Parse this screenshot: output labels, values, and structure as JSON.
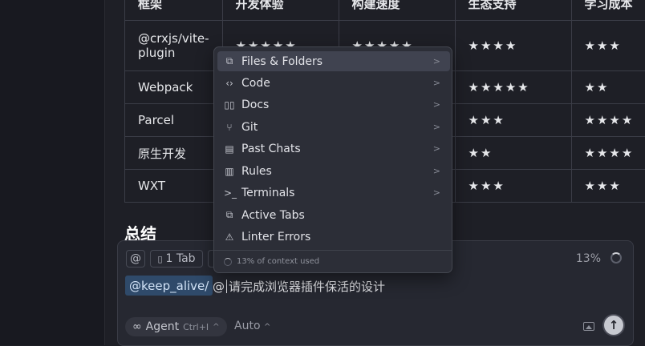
{
  "table": {
    "headers": [
      "框架",
      "开发体验",
      "构建速度",
      "生态支持",
      "学习成本"
    ],
    "rows": [
      {
        "name": "@crxjs/vite-plugin",
        "dev": "★★★★★",
        "build": "★★★★★",
        "eco": "★★★★",
        "learn": "★★★"
      },
      {
        "name": "Webpack",
        "dev": "",
        "build": "",
        "eco": "★★★★★",
        "learn": "★★"
      },
      {
        "name": "Parcel",
        "dev": "",
        "build": "",
        "eco": "★★★",
        "learn": "★★★★"
      },
      {
        "name": "原生开发",
        "dev": "",
        "build": "",
        "eco": "★★",
        "learn": "★★★★"
      },
      {
        "name": "WXT",
        "dev": "",
        "build": "",
        "eco": "★★★",
        "learn": "★★★"
      }
    ]
  },
  "summary_heading": "总结",
  "dropdown": {
    "items": [
      {
        "label": "Files & Folders",
        "icon": "files-icon",
        "glyph": "⧉",
        "submenu": true,
        "active": true
      },
      {
        "label": "Code",
        "icon": "code-icon",
        "glyph": "‹›",
        "submenu": true
      },
      {
        "label": "Docs",
        "icon": "book-icon",
        "glyph": "▯▯",
        "submenu": true
      },
      {
        "label": "Git",
        "icon": "git-branch-icon",
        "glyph": "⑂",
        "submenu": true
      },
      {
        "label": "Past Chats",
        "icon": "history-icon",
        "glyph": "▤",
        "submenu": true
      },
      {
        "label": "Rules",
        "icon": "rules-icon",
        "glyph": "▥",
        "submenu": true
      },
      {
        "label": "Terminals",
        "icon": "terminal-icon",
        "glyph": ">_",
        "submenu": true
      },
      {
        "label": "Active Tabs",
        "icon": "tabs-icon",
        "glyph": "⧉",
        "submenu": false
      },
      {
        "label": "Linter Errors",
        "icon": "warning-icon",
        "glyph": "⚠",
        "submenu": false
      }
    ],
    "footer": "13% of context used"
  },
  "composer": {
    "at_symbol": "@",
    "tab_chip": "1 Tab",
    "context_percent": "13%",
    "mention": "@keep_alive/",
    "at_prefix": "@",
    "input_text": "请完成浏览器插件保活的设计",
    "agent_label": "Agent",
    "agent_shortcut": "Ctrl+I",
    "auto_label": "Auto",
    "send_glyph": "↑"
  }
}
